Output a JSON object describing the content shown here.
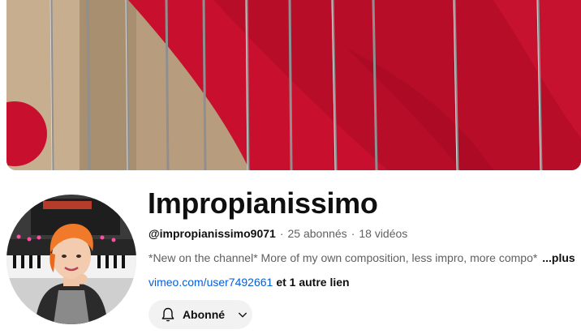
{
  "channel": {
    "name": "Impropianissimo",
    "handle": "@impropianissimo9071",
    "subscribers": "25 abonnés",
    "videos": "18 vidéos",
    "separator": "·",
    "description": "*New on the channel* More of my own composition, less impro, more compo*",
    "more_label": "...plus",
    "link": "vimeo.com/user7492661",
    "other_links": "et 1 autre lien"
  },
  "subscribe_button": {
    "label": "Abonné",
    "bell_icon": "bell-icon",
    "chevron_icon": "chevron-down-icon"
  },
  "colors": {
    "felt_red": "#c8102e",
    "link_blue": "#065fd4",
    "button_bg": "#f2f2f2",
    "secondary_text": "#606060"
  }
}
